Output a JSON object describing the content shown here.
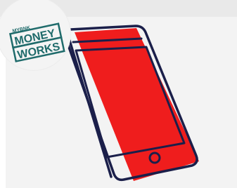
{
  "logo": {
    "kicker": "MYBNK",
    "line1": "MONEY",
    "line2": "WORKS",
    "color": "#1f6b6b"
  },
  "illustration": {
    "subject": "smartphone-icon",
    "fill_color": "#ef1d1d",
    "outline_color": "#1b1f4a"
  }
}
